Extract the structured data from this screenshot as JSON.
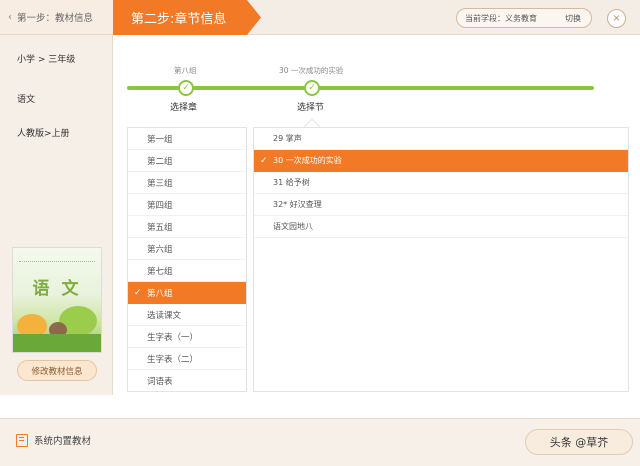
{
  "header": {
    "step1_label": "第一步：教材信息",
    "step1_back_icon": "‹",
    "step2_label": "第二步:章节信息",
    "school_label": "当前学段：义务教育",
    "school_switch": "切换",
    "close_symbol": "×"
  },
  "sidebar": {
    "items": [
      {
        "label": "小学 > 三年级"
      },
      {
        "label": "语文"
      },
      {
        "label": "人教版>上册"
      }
    ],
    "book_title": "语 文",
    "edit_button": "修改教材信息"
  },
  "progress": {
    "steps": [
      {
        "caption": "第八组",
        "label": "选择章"
      },
      {
        "caption": "30 一次成功的实验",
        "label": "选择节"
      }
    ],
    "check_symbol": "✓",
    "accent": "#8cc63f"
  },
  "groups": {
    "items": [
      {
        "label": "第一组"
      },
      {
        "label": "第二组"
      },
      {
        "label": "第三组"
      },
      {
        "label": "第四组"
      },
      {
        "label": "第五组"
      },
      {
        "label": "第六组"
      },
      {
        "label": "第七组"
      },
      {
        "label": "第八组",
        "selected": true
      },
      {
        "label": "选读课文"
      },
      {
        "label": "生字表（一）"
      },
      {
        "label": "生字表（二）"
      },
      {
        "label": "词语表"
      }
    ]
  },
  "lessons": {
    "items": [
      {
        "label": "29 掌声"
      },
      {
        "label": "30 一次成功的实验",
        "selected": true
      },
      {
        "label": "31 给予树"
      },
      {
        "label": "32* 好汉查理"
      },
      {
        "label": "语文园地八"
      }
    ]
  },
  "footer": {
    "builtin_label": "系统内置教材",
    "next_button": "头条 @草芥"
  },
  "colors": {
    "accent": "#f27a27",
    "progress": "#8cc63f"
  }
}
